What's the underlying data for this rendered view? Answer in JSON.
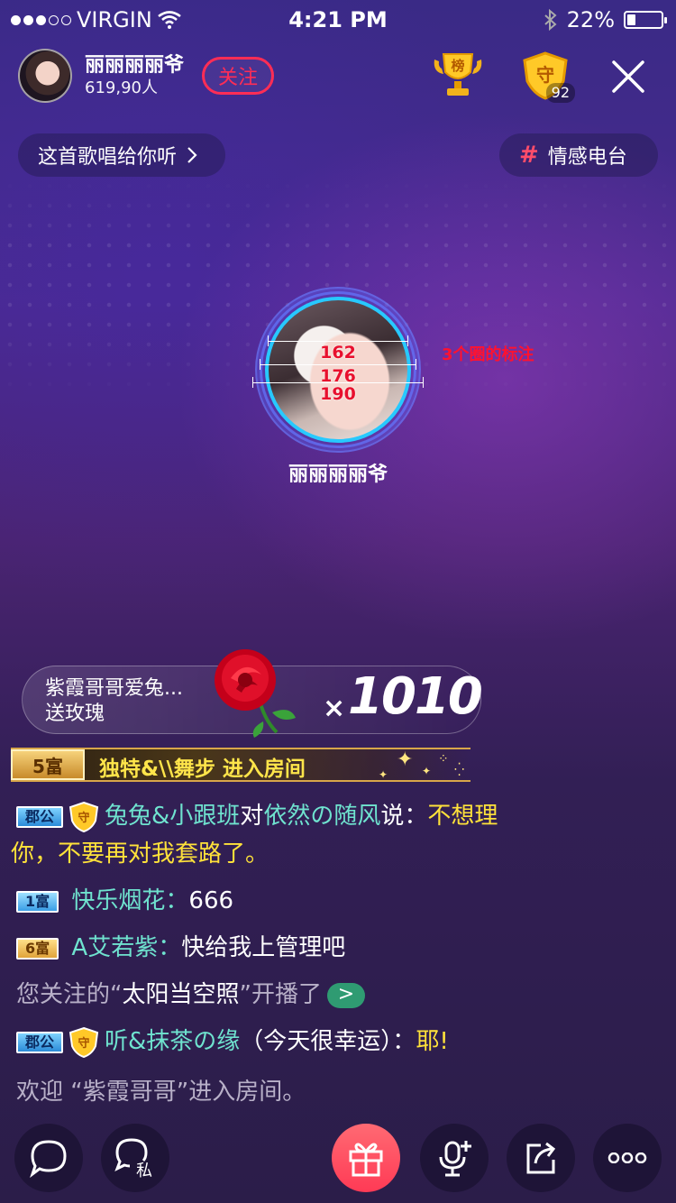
{
  "status_bar": {
    "carrier": "VIRGIN",
    "time": "4:21 PM",
    "battery": "22%"
  },
  "host": {
    "name": "丽丽丽丽爷",
    "audience": "619,90人",
    "follow_label": "关注"
  },
  "guard": {
    "count": "92"
  },
  "rank_icon_char": "榜",
  "guard_icon_char": "守",
  "song_pill": "这首歌唱给你听",
  "radio_pill": {
    "hash": "#",
    "label": "情感电台"
  },
  "avatar_measure": {
    "inner": "162",
    "middle": "176",
    "outer": "190",
    "annotation": "3个圈的标注"
  },
  "center_name": "丽丽丽丽爷",
  "gift": {
    "sender": "紫霞哥哥爱兔...",
    "action": "送玫瑰",
    "multiplier": "×",
    "count": "1010"
  },
  "entry": {
    "badge": "5富",
    "text": "独特&\\\\舞步 进入房间"
  },
  "chat": [
    {
      "badge": "郡公",
      "shield": "守",
      "user": "兔兔&小跟班",
      "mid": "对",
      "target": "依然の随风",
      "say": "说：",
      "message_a": "不想理",
      "message_b": "你，不要再对我套路了。"
    },
    {
      "badge": "1富",
      "user": "快乐烟花：",
      "message": "666"
    },
    {
      "badge": "6富",
      "user": "A艾若紫：",
      "message": "快给我上管理吧"
    },
    {
      "prefix": "您关注的“",
      "name": "太阳当空照",
      "suffix": "”开播了",
      "go": ">"
    },
    {
      "badge": "郡公",
      "shield": "守",
      "user": "听&抹茶の缘",
      "paren": "（今天很幸运）：",
      "message": "耶!"
    },
    {
      "prefix": "欢迎 “紫霞哥哥”进入房间。"
    }
  ],
  "bottom_bar": {
    "private_label": "私"
  },
  "icons": {
    "wifi": "wifi-icon",
    "bluetooth": "bluetooth-icon",
    "rank": "trophy-icon",
    "guard": "shield-icon",
    "close": "close-icon",
    "chat": "chat-bubble-icon",
    "private": "private-message-icon",
    "gift": "gift-icon",
    "mic": "mic-add-icon",
    "share": "share-icon",
    "more": "more-icon"
  },
  "colors": {
    "follow": "#ff2d55",
    "teal_user": "#6fe3cf",
    "yellow_msg": "#ffe23a",
    "avatar_ring": "#27c9ff",
    "gift_button": "#ff3a55"
  }
}
